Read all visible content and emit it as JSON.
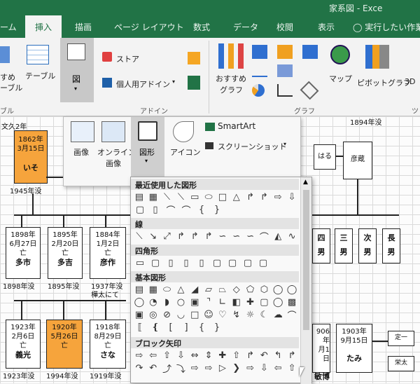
{
  "window": {
    "title": "家系図 - Exce"
  },
  "tabs": [
    "ーム",
    "挿入",
    "描画",
    "ページ レイアウト",
    "数式",
    "データ",
    "校閲",
    "表示"
  ],
  "tell_me": "実行したい作業を",
  "ribbon": {
    "suru": "すめ",
    "table_left": "ーブル",
    "table_label": "テーブル",
    "zu_label": "図",
    "store": "ストア",
    "addins": "個人用アドイン",
    "recommended_charts_1": "おすすめ",
    "recommended_charts_2": "グラフ",
    "map": "マップ",
    "pivot_chart": "ピボットグラフ",
    "3d": "3D",
    "group_table": "ブル",
    "group_addins": "アドイン",
    "group_charts": "グラフ",
    "group_tour": "ツ"
  },
  "insert_panel": {
    "picture": "画像",
    "online_1": "オンライン",
    "online_2": "画像",
    "shapes": "図形",
    "icons": "アイコン",
    "smartart": "SmartArt",
    "screenshot": "スクリーンショット"
  },
  "shape_panel": {
    "recent": "最近使用した図形",
    "lines": "線",
    "rectangles": "四角形",
    "basic": "基本図形",
    "block_arrows": "ブロック矢印"
  },
  "sheet": {
    "top_note": "文久2年",
    "right_note": "1894年没",
    "iso": {
      "year": "1862年",
      "date": "3月15日",
      "name": "いそ",
      "death": "1945年没"
    },
    "c1": {
      "year": "1898年",
      "date": "6月27日",
      "mark": "亡",
      "name": "多市",
      "death": "1898年没"
    },
    "c2": {
      "year": "1895年",
      "date": "2月20日",
      "mark": "亡",
      "name": "多吉",
      "death": "1895年没"
    },
    "c3": {
      "year": "1884年",
      "date": "1月2日",
      "mark": "亡",
      "name": "彦作",
      "death": "1937年没",
      "note": "樺太にて"
    },
    "haru": "はる",
    "hikozou": "彦蔵",
    "sons": [
      "四",
      "男",
      "三",
      "男",
      "次",
      "男",
      "長",
      "男"
    ],
    "g1": {
      "year": "1923年",
      "date": "2月6日",
      "mark": "亡",
      "name": "義光",
      "death": "1923年没"
    },
    "g2": {
      "year": "1920年",
      "date": "5月26日",
      "mark": "亡",
      "name": "",
      "death": "1994年没"
    },
    "g3": {
      "year": "1918年",
      "date": "8月29日",
      "mark": "亡",
      "name": "さな",
      "death": "1919年没"
    },
    "r1": {
      "year": "906年",
      "date": "月1日",
      "name": "敏博"
    },
    "r2": {
      "year": "1903年",
      "date": "9月15日",
      "name": "たみ"
    },
    "teiichi": "定一",
    "eita": "栄太"
  }
}
